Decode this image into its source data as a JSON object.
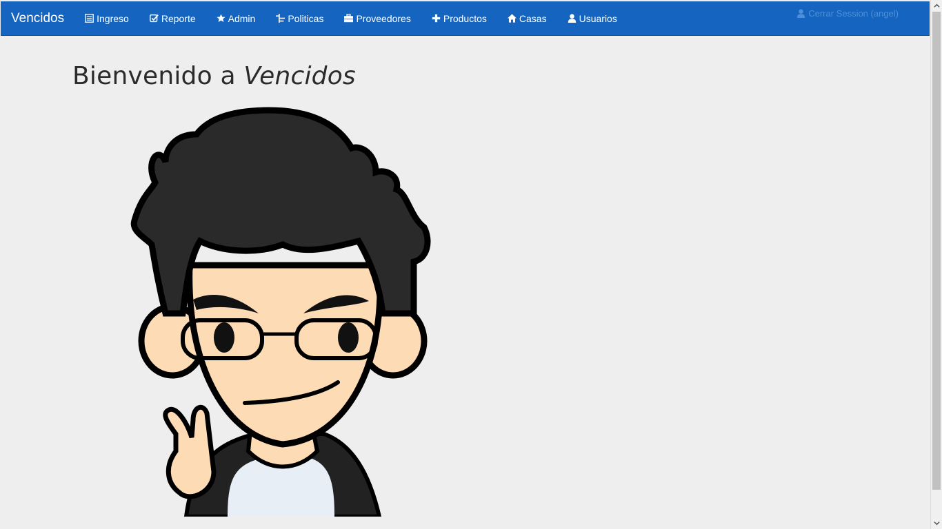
{
  "nav": {
    "brand": "Vencidos",
    "items": [
      {
        "label": "Ingreso",
        "icon": "list-icon"
      },
      {
        "label": "Reporte",
        "icon": "check-square-icon"
      },
      {
        "label": "Admin",
        "icon": "star-icon"
      },
      {
        "label": "Politicas",
        "icon": "tree-icon"
      },
      {
        "label": "Proveedores",
        "icon": "briefcase-icon"
      },
      {
        "label": "Productos",
        "icon": "plus-icon"
      },
      {
        "label": "Casas",
        "icon": "home-icon"
      },
      {
        "label": "Usuarios",
        "icon": "user-icon"
      }
    ],
    "logout": "Cerrar Session (angel)"
  },
  "main": {
    "welcome_prefix": "Bienvenido a ",
    "welcome_app": "Vencidos"
  },
  "colors": {
    "navbar": "#1565c0",
    "background": "#eeeeee",
    "logout_text": "#4f8fd8"
  }
}
